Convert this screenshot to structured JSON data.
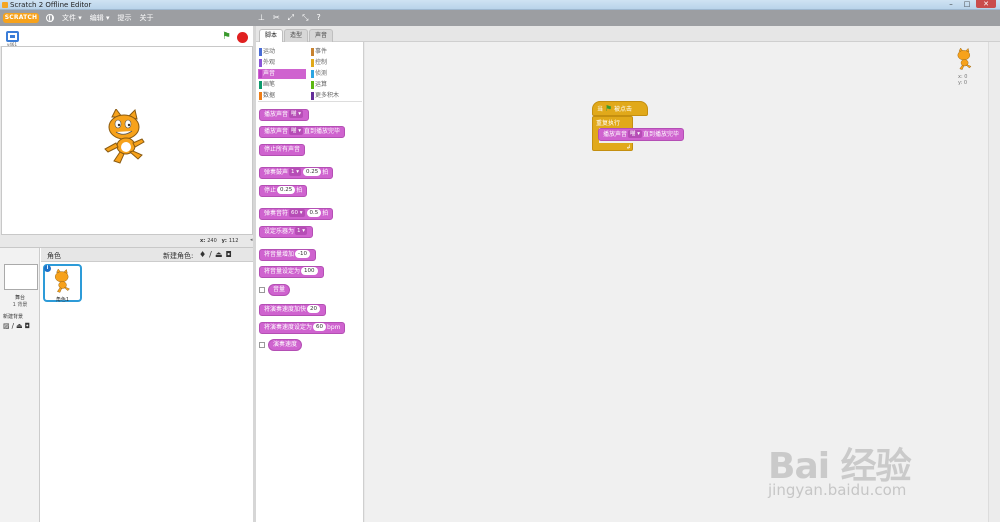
{
  "window": {
    "title": "Scratch 2 Offline Editor",
    "minimize": "–",
    "maximize": "□",
    "close": "✕"
  },
  "menubar": {
    "logo": "SCRATCH",
    "items": [
      "文件 ▾",
      "编辑 ▾",
      "提示",
      "关于"
    ]
  },
  "stage": {
    "version": "v461"
  },
  "coords": {
    "x_label": "x:",
    "x_value": "240",
    "y_label": "y:",
    "y_value": "112"
  },
  "sprites": {
    "title": "角色",
    "new_sprite_label": "新建角色:",
    "stage_label": "舞台",
    "stage_backdrops": "1 背景",
    "new_backdrop_label": "新建背景",
    "sprite_name": "角色1",
    "info": "i"
  },
  "tabs": [
    "脚本",
    "造型",
    "声音"
  ],
  "categories": [
    {
      "label": "运动",
      "color": "#4a6cd4"
    },
    {
      "label": "事件",
      "color": "#c88330"
    },
    {
      "label": "外观",
      "color": "#8a55d7"
    },
    {
      "label": "控制",
      "color": "#e1a91a"
    },
    {
      "label": "声音",
      "color": "#bb42c3"
    },
    {
      "label": "侦测",
      "color": "#2ca5e2"
    },
    {
      "label": "画笔",
      "color": "#0e9a6c"
    },
    {
      "label": "运算",
      "color": "#5cb712"
    },
    {
      "label": "数据",
      "color": "#ee7d16"
    },
    {
      "label": "更多积木",
      "color": "#632d99"
    }
  ],
  "blocks": {
    "play_sound": {
      "text": "播放声音",
      "dd": "喵 ▾"
    },
    "play_sound_until": {
      "text": "播放声音",
      "dd": "喵 ▾",
      "suffix": "直到播放完毕"
    },
    "stop_all": "停止所有声音",
    "play_drum": {
      "text": "弹奏鼓声",
      "dd": "1 ▾",
      "val": "0.25",
      "suffix": "拍"
    },
    "rest": {
      "text": "停止",
      "val": "0.25",
      "suffix": "拍"
    },
    "play_note": {
      "text": "弹奏音符",
      "dd": "60 ▾",
      "val": "0.5",
      "suffix": "拍"
    },
    "set_instrument": {
      "text": "设定乐器为",
      "dd": "1 ▾"
    },
    "change_volume": {
      "text": "将音量增加",
      "val": "-10"
    },
    "set_volume": {
      "text": "将音量设定为",
      "val": "100"
    },
    "volume": "音量",
    "change_tempo": {
      "text": "将演奏速度加快",
      "val": "20"
    },
    "set_tempo": {
      "text": "将演奏速度设定为",
      "val": "60",
      "suffix": "bpm"
    },
    "tempo": "演奏速度"
  },
  "script": {
    "hat_when": "当",
    "hat_clicked": "被点击",
    "forever": "重复执行",
    "inner_text": "播放声音",
    "inner_dd": "喵 ▾",
    "inner_suffix": "直到播放完毕",
    "loop_arrow": "↲"
  },
  "corner": {
    "x": "x: 0",
    "y": "y: 0"
  },
  "watermark": {
    "main": "Bai 经验",
    "sub": "jingyan.baidu.com"
  }
}
